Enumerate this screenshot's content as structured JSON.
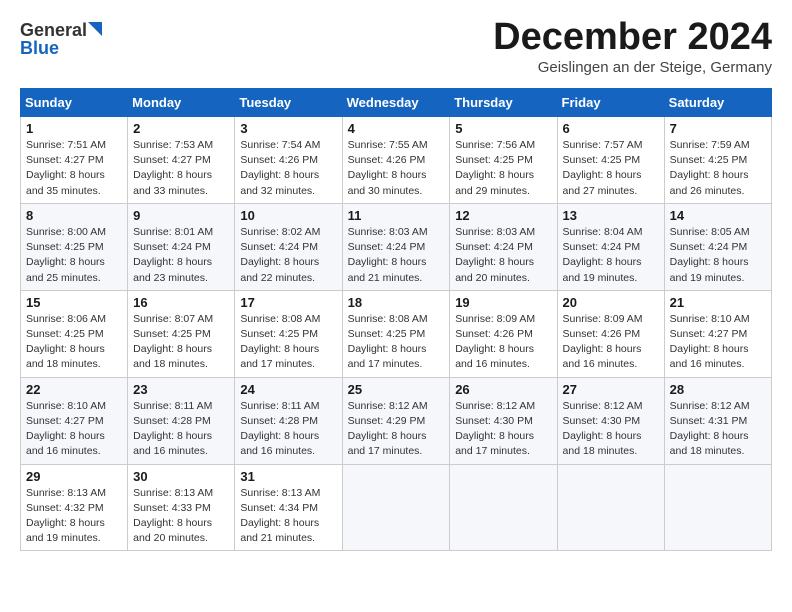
{
  "logo": {
    "general": "General",
    "blue": "Blue"
  },
  "title": "December 2024",
  "location": "Geislingen an der Steige, Germany",
  "days_of_week": [
    "Sunday",
    "Monday",
    "Tuesday",
    "Wednesday",
    "Thursday",
    "Friday",
    "Saturday"
  ],
  "weeks": [
    [
      {
        "day": 1,
        "sunrise": "7:51 AM",
        "sunset": "4:27 PM",
        "daylight": "8 hours and 35 minutes."
      },
      {
        "day": 2,
        "sunrise": "7:53 AM",
        "sunset": "4:27 PM",
        "daylight": "8 hours and 33 minutes."
      },
      {
        "day": 3,
        "sunrise": "7:54 AM",
        "sunset": "4:26 PM",
        "daylight": "8 hours and 32 minutes."
      },
      {
        "day": 4,
        "sunrise": "7:55 AM",
        "sunset": "4:26 PM",
        "daylight": "8 hours and 30 minutes."
      },
      {
        "day": 5,
        "sunrise": "7:56 AM",
        "sunset": "4:25 PM",
        "daylight": "8 hours and 29 minutes."
      },
      {
        "day": 6,
        "sunrise": "7:57 AM",
        "sunset": "4:25 PM",
        "daylight": "8 hours and 27 minutes."
      },
      {
        "day": 7,
        "sunrise": "7:59 AM",
        "sunset": "4:25 PM",
        "daylight": "8 hours and 26 minutes."
      }
    ],
    [
      {
        "day": 8,
        "sunrise": "8:00 AM",
        "sunset": "4:25 PM",
        "daylight": "8 hours and 25 minutes."
      },
      {
        "day": 9,
        "sunrise": "8:01 AM",
        "sunset": "4:24 PM",
        "daylight": "8 hours and 23 minutes."
      },
      {
        "day": 10,
        "sunrise": "8:02 AM",
        "sunset": "4:24 PM",
        "daylight": "8 hours and 22 minutes."
      },
      {
        "day": 11,
        "sunrise": "8:03 AM",
        "sunset": "4:24 PM",
        "daylight": "8 hours and 21 minutes."
      },
      {
        "day": 12,
        "sunrise": "8:03 AM",
        "sunset": "4:24 PM",
        "daylight": "8 hours and 20 minutes."
      },
      {
        "day": 13,
        "sunrise": "8:04 AM",
        "sunset": "4:24 PM",
        "daylight": "8 hours and 19 minutes."
      },
      {
        "day": 14,
        "sunrise": "8:05 AM",
        "sunset": "4:24 PM",
        "daylight": "8 hours and 19 minutes."
      }
    ],
    [
      {
        "day": 15,
        "sunrise": "8:06 AM",
        "sunset": "4:25 PM",
        "daylight": "8 hours and 18 minutes."
      },
      {
        "day": 16,
        "sunrise": "8:07 AM",
        "sunset": "4:25 PM",
        "daylight": "8 hours and 18 minutes."
      },
      {
        "day": 17,
        "sunrise": "8:08 AM",
        "sunset": "4:25 PM",
        "daylight": "8 hours and 17 minutes."
      },
      {
        "day": 18,
        "sunrise": "8:08 AM",
        "sunset": "4:25 PM",
        "daylight": "8 hours and 17 minutes."
      },
      {
        "day": 19,
        "sunrise": "8:09 AM",
        "sunset": "4:26 PM",
        "daylight": "8 hours and 16 minutes."
      },
      {
        "day": 20,
        "sunrise": "8:09 AM",
        "sunset": "4:26 PM",
        "daylight": "8 hours and 16 minutes."
      },
      {
        "day": 21,
        "sunrise": "8:10 AM",
        "sunset": "4:27 PM",
        "daylight": "8 hours and 16 minutes."
      }
    ],
    [
      {
        "day": 22,
        "sunrise": "8:10 AM",
        "sunset": "4:27 PM",
        "daylight": "8 hours and 16 minutes."
      },
      {
        "day": 23,
        "sunrise": "8:11 AM",
        "sunset": "4:28 PM",
        "daylight": "8 hours and 16 minutes."
      },
      {
        "day": 24,
        "sunrise": "8:11 AM",
        "sunset": "4:28 PM",
        "daylight": "8 hours and 16 minutes."
      },
      {
        "day": 25,
        "sunrise": "8:12 AM",
        "sunset": "4:29 PM",
        "daylight": "8 hours and 17 minutes."
      },
      {
        "day": 26,
        "sunrise": "8:12 AM",
        "sunset": "4:30 PM",
        "daylight": "8 hours and 17 minutes."
      },
      {
        "day": 27,
        "sunrise": "8:12 AM",
        "sunset": "4:30 PM",
        "daylight": "8 hours and 18 minutes."
      },
      {
        "day": 28,
        "sunrise": "8:12 AM",
        "sunset": "4:31 PM",
        "daylight": "8 hours and 18 minutes."
      }
    ],
    [
      {
        "day": 29,
        "sunrise": "8:13 AM",
        "sunset": "4:32 PM",
        "daylight": "8 hours and 19 minutes."
      },
      {
        "day": 30,
        "sunrise": "8:13 AM",
        "sunset": "4:33 PM",
        "daylight": "8 hours and 20 minutes."
      },
      {
        "day": 31,
        "sunrise": "8:13 AM",
        "sunset": "4:34 PM",
        "daylight": "8 hours and 21 minutes."
      },
      null,
      null,
      null,
      null
    ]
  ]
}
